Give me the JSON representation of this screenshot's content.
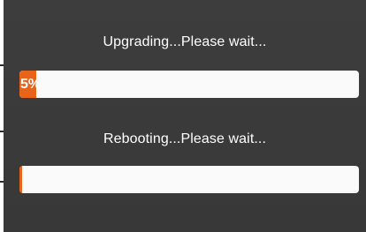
{
  "upgrade": {
    "label": "Upgrading...Please wait...",
    "progress_percent": 5,
    "progress_text": "5%"
  },
  "reboot": {
    "label": "Rebooting...Please wait...",
    "progress_percent": 0
  },
  "colors": {
    "dialog_background": "#3a3a3a",
    "progress_fill": "#e8641b",
    "progress_track": "#fafafa",
    "text": "#ffffff"
  }
}
